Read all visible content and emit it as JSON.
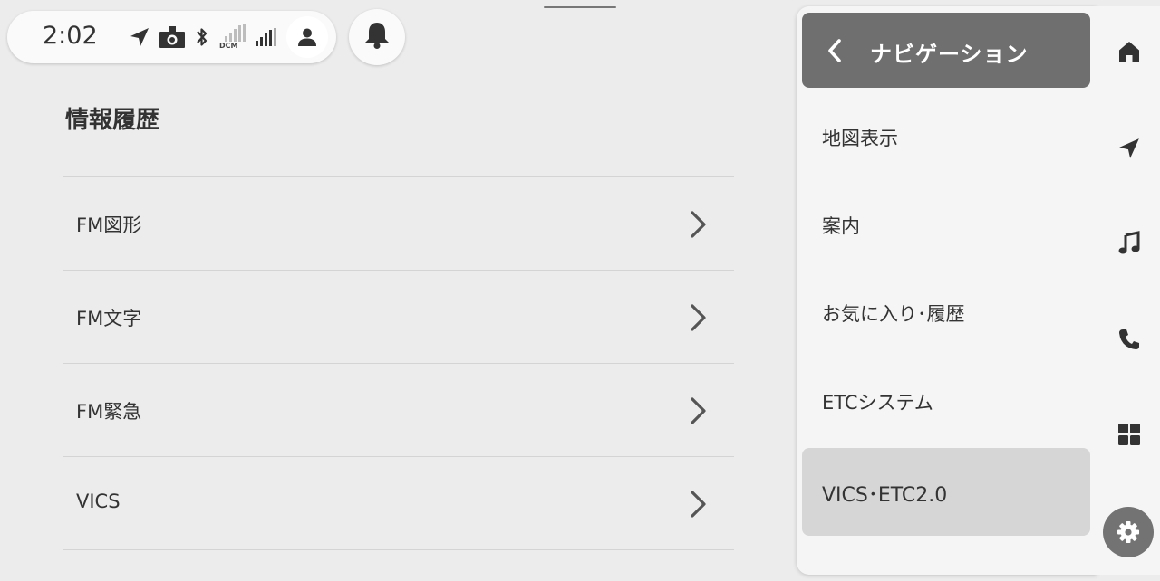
{
  "status_bar": {
    "time": "2:02",
    "icons": [
      "navigation-arrow-icon",
      "dashcam-icon",
      "bluetooth-icon",
      "dcm-signal-icon",
      "cellular-signal-icon",
      "user-profile-icon"
    ],
    "dcm_label": "DCM"
  },
  "notification": {
    "icon": "bell-icon"
  },
  "page": {
    "title": "情報履歴",
    "items": [
      {
        "label": "FM図形"
      },
      {
        "label": "FM文字"
      },
      {
        "label": "FM緊急"
      },
      {
        "label": "VICS"
      }
    ]
  },
  "nav_menu": {
    "title": "ナビゲーション",
    "items": [
      {
        "label": "地図表示"
      },
      {
        "label": "案内"
      },
      {
        "label": "お気に入り･履歴"
      },
      {
        "label": "ETCシステム"
      },
      {
        "label": "VICS･ETC2.0"
      }
    ],
    "selected_index": 4
  },
  "rail": {
    "icons": [
      "home-icon",
      "navigation-icon",
      "music-icon",
      "phone-icon",
      "apps-grid-icon",
      "settings-gear-icon"
    ],
    "active": "settings-gear-icon"
  },
  "colors": {
    "background": "#ececec",
    "panel": "#f5f5f5",
    "header": "#6f6f6f",
    "selected": "#d6d6d6",
    "active_rail": "#737373"
  }
}
